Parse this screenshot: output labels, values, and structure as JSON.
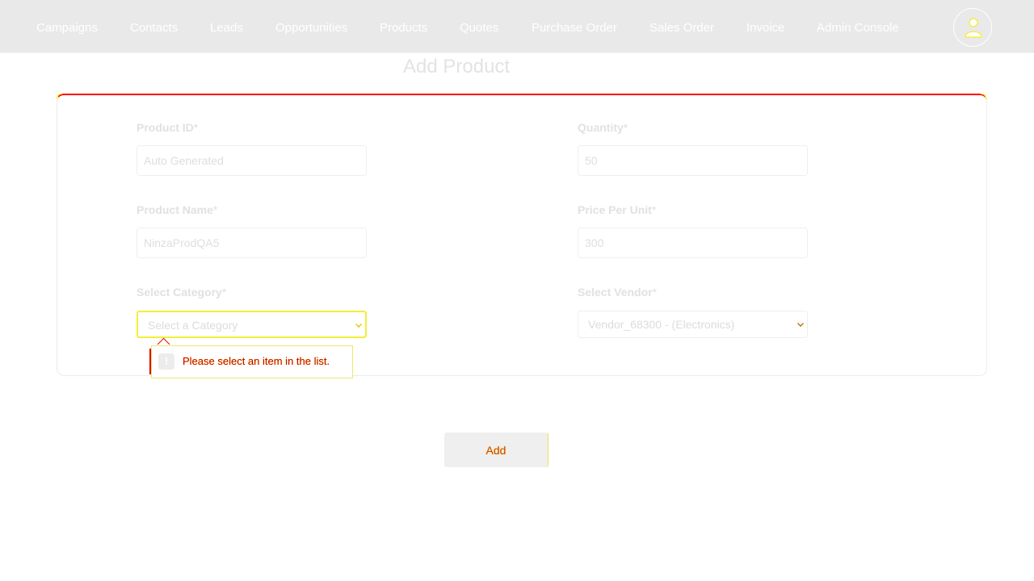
{
  "nav": {
    "items": [
      "Campaigns",
      "Contacts",
      "Leads",
      "Opportunities",
      "Products",
      "Quotes",
      "Purchase Order",
      "Sales Order",
      "Invoice",
      "Admin Console"
    ]
  },
  "page": {
    "title": "Add Product"
  },
  "form": {
    "product_id": {
      "label": "Product ID",
      "required": "*",
      "value": "Auto Generated"
    },
    "quantity": {
      "label": "Quantity",
      "required": "*",
      "value": "50"
    },
    "product_name": {
      "label": "Product Name",
      "required": "*",
      "value": "NinzaProdQA5"
    },
    "price_per_unit": {
      "label": "Price Per Unit",
      "required": "*",
      "value": "300"
    },
    "category": {
      "label": "Select Category",
      "required": "*",
      "selected": "Select a Category"
    },
    "vendor": {
      "label": "Select Vendor",
      "required": "*",
      "selected": "Vendor_68300 - (Electronics)"
    }
  },
  "validation": {
    "icon": "!",
    "message": "Please select an item in the list."
  },
  "actions": {
    "add_label": "Add"
  },
  "colors": {
    "nav_bg": "#e9e9e9",
    "error": "#ff0000",
    "focus_outline": "#f2ef3a"
  }
}
